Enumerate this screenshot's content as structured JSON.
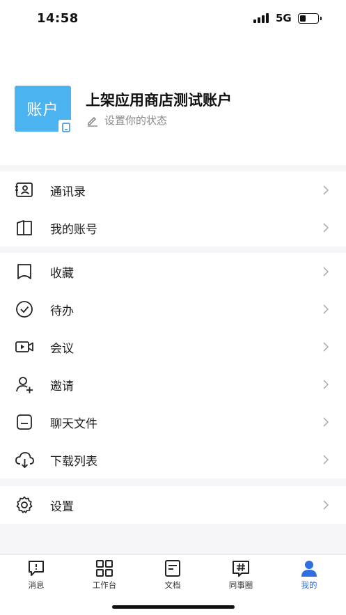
{
  "status_bar": {
    "time": "14:58",
    "network": "5G",
    "battery_level": 0.35
  },
  "profile": {
    "avatar_text": "账户",
    "avatar_color": "#4bb3f0",
    "name": "上架应用商店测试账户",
    "status_placeholder": "设置你的状态"
  },
  "menu": {
    "group1": [
      {
        "label": "通讯录",
        "icon": "contacts-icon"
      },
      {
        "label": "我的账号",
        "icon": "account-book-icon"
      }
    ],
    "group2": [
      {
        "label": "收藏",
        "icon": "bookmark-icon"
      },
      {
        "label": "待办",
        "icon": "check-circle-icon"
      },
      {
        "label": "会议",
        "icon": "video-icon"
      },
      {
        "label": "邀请",
        "icon": "add-user-icon"
      },
      {
        "label": "聊天文件",
        "icon": "file-icon"
      },
      {
        "label": "下载列表",
        "icon": "cloud-download-icon"
      }
    ],
    "group3": [
      {
        "label": "设置",
        "icon": "gear-icon"
      }
    ]
  },
  "tabbar": {
    "tabs": [
      {
        "label": "消息",
        "icon": "message-icon"
      },
      {
        "label": "工作台",
        "icon": "grid-icon"
      },
      {
        "label": "文档",
        "icon": "document-icon"
      },
      {
        "label": "同事圈",
        "icon": "hashtag-icon"
      },
      {
        "label": "我的",
        "icon": "person-icon",
        "active": true
      }
    ],
    "active_color": "#2f6fe0"
  }
}
